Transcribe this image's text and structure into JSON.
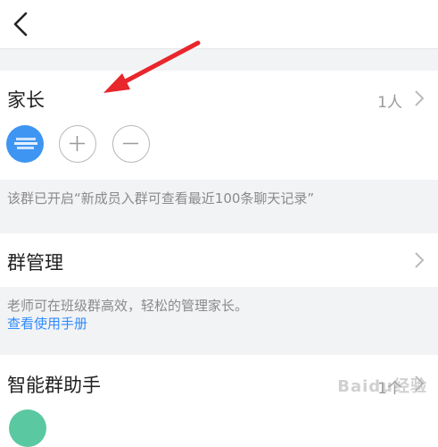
{
  "nav": {
    "back_icon": "chevron-left-icon"
  },
  "parents": {
    "title": "家长",
    "count": "1人",
    "add_icon": "plus-circle-icon",
    "remove_icon": "minus-circle-icon",
    "note": "该群已开启“新成员入群可查看最近100条聊天记录”"
  },
  "manage": {
    "title": "群管理",
    "desc": "老师可在班级群高效，轻松的管理家长。",
    "link": "查看使用手册"
  },
  "assistant": {
    "title": "智能群助手",
    "count": "1个"
  },
  "watermark": {
    "text": "Baidu经验"
  },
  "colors": {
    "accent": "#2f8cff",
    "annotation_arrow": "#e8262c",
    "avatar": "#3e95f2",
    "green": "#5ac8a0"
  }
}
